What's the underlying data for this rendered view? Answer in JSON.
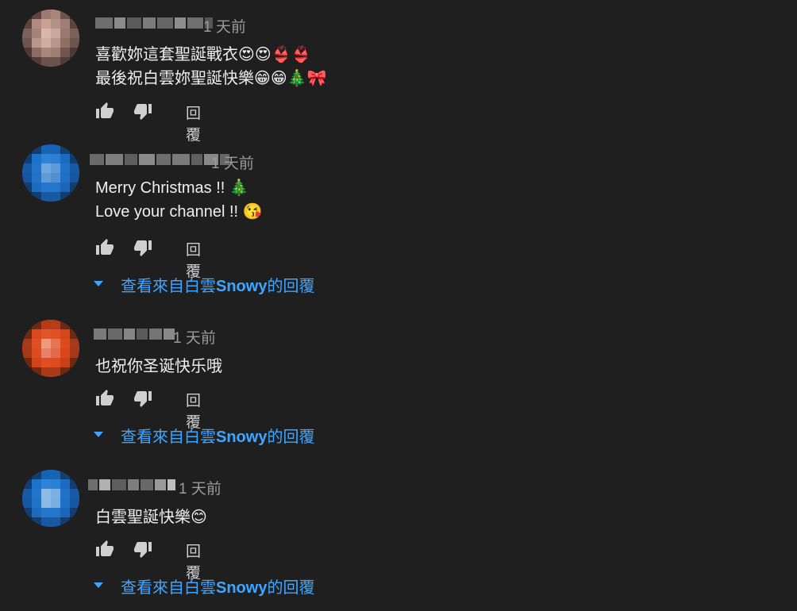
{
  "comments": [
    {
      "time": "1 天前",
      "lines": [
        "喜歡妳這套聖誕戰衣😍😍👙👙",
        "最後祝白雲妳聖誕快樂😁😁🎄🎀"
      ],
      "reply_label": "回覆",
      "view_replies": null,
      "avatar_color": "#a3837a"
    },
    {
      "time": "1 天前",
      "lines": [
        "Merry Christmas !! 🎄",
        "Love your channel !! 😘"
      ],
      "reply_label": "回覆",
      "view_replies": {
        "prefix": "查看來自白雲",
        "name": "Snowy",
        "suffix": "的回覆"
      },
      "avatar_color": "#1e6fbf"
    },
    {
      "time": "1 天前",
      "lines": [
        "也祝你圣诞快乐哦"
      ],
      "reply_label": "回覆",
      "view_replies": {
        "prefix": "查看來自白雲",
        "name": "Snowy",
        "suffix": "的回覆"
      },
      "avatar_color": "#d4461f"
    },
    {
      "time": "1 天前",
      "lines": [
        "白雲聖誕快樂😊"
      ],
      "reply_label": "回覆",
      "view_replies": {
        "prefix": "查看來自白雲",
        "name": "Snowy",
        "suffix": "的回覆"
      },
      "avatar_color": "#1e6fbf"
    }
  ],
  "colors": {
    "background": "#1f1f1f",
    "link": "#3ea6ff",
    "muted": "#9a9a9a"
  }
}
